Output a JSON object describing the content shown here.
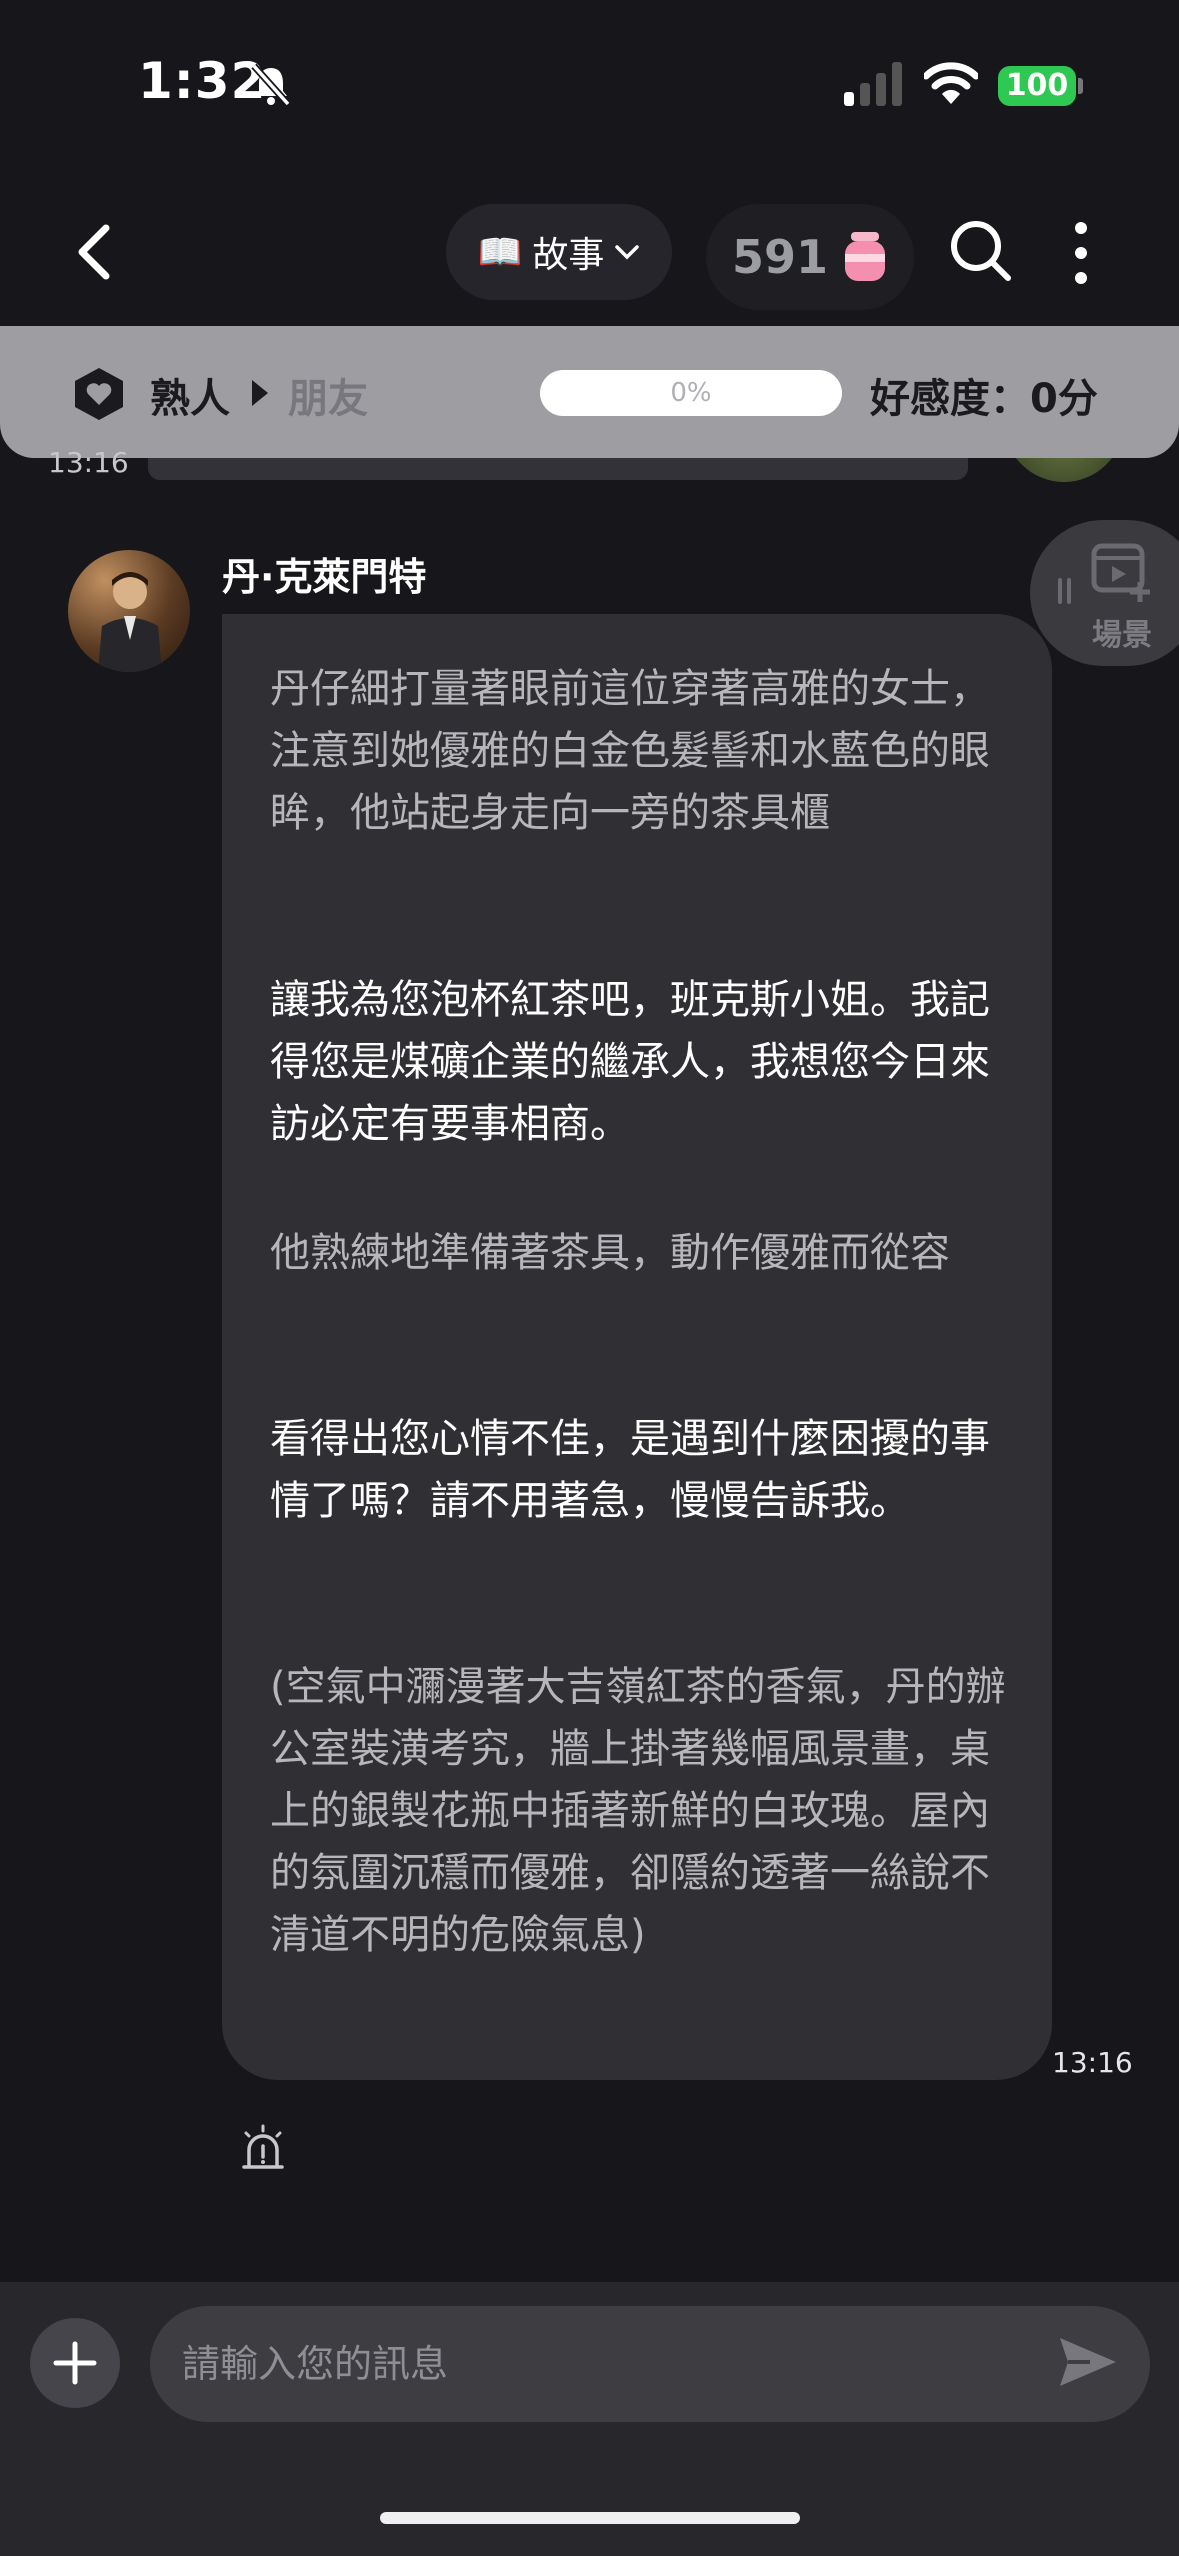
{
  "status_bar": {
    "time": "1:32",
    "battery": "100"
  },
  "header": {
    "mode_label": "故事",
    "mode_emoji": "📖",
    "gem_count": "591"
  },
  "affinity": {
    "relation_current": "熟人",
    "relation_next": "朋友",
    "progress_text": "0%",
    "progress_value": 0,
    "score_label": "好感度：0分"
  },
  "previous": {
    "time": "13:16"
  },
  "scene": {
    "label": "場景"
  },
  "message": {
    "sender": "丹·克萊門特",
    "time": "13:16",
    "paragraphs": [
      "丹仔細打量著眼前這位穿著高雅的女士，注意到她優雅的白金色髮髻和水藍色的眼眸，他站起身走向一旁的茶具櫃",
      "讓我為您泡杯紅茶吧，班克斯小姐。我記得您是煤礦企業的繼承人，我想您今日來訪必定有要事相商。",
      "他熟練地準備著茶具，動作優雅而從容",
      "看得出您心情不佳，是遇到什麼困擾的事情了嗎？請不用著急，慢慢告訴我。",
      "(空氣中瀰漫著大吉嶺紅茶的香氣，丹的辦公室裝潢考究，牆上掛著幾幅風景畫，桌上的銀製花瓶中插著新鮮的白玫瑰。屋內的氛圍沉穩而優雅，卻隱約透著一絲說不清道不明的危險氣息)"
    ]
  },
  "input": {
    "placeholder": "請輸入您的訊息"
  },
  "colors": {
    "battery": "#2fc852",
    "affinity_bar": "#9d9da2",
    "bubble": "#2f2f34",
    "background": "#17171b"
  }
}
